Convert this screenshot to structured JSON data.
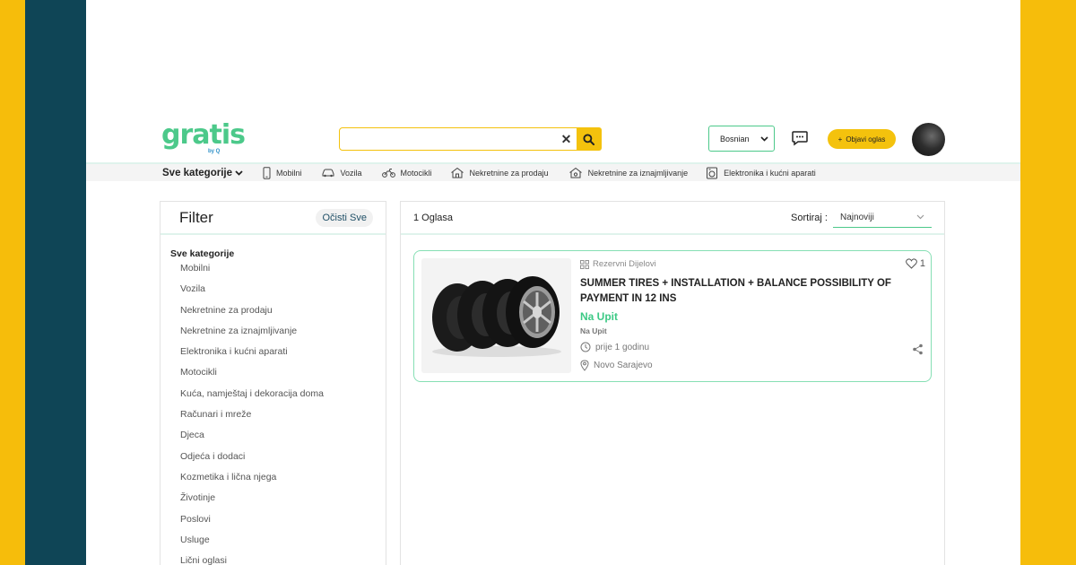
{
  "brand": {
    "logo_text": "gratis",
    "logo_sub": "by Q"
  },
  "search": {
    "value": "",
    "placeholder": ""
  },
  "header": {
    "language": "Bosnian",
    "post_ad_label": "Objavi oglas",
    "post_ad_icon": "+"
  },
  "categories_bar": {
    "all_label": "Sve kategorije",
    "items": [
      {
        "label": "Mobilni",
        "icon": "phone-icon"
      },
      {
        "label": "Vozila",
        "icon": "car-icon"
      },
      {
        "label": "Motocikli",
        "icon": "motorcycle-icon"
      },
      {
        "label": "Nekretnine za prodaju",
        "icon": "house-sale-icon"
      },
      {
        "label": "Nekretnine za iznajmljivanje",
        "icon": "house-rent-icon"
      },
      {
        "label": "Elektronika i kućni aparati",
        "icon": "appliance-icon"
      }
    ]
  },
  "filter": {
    "title": "Filter",
    "clear_label": "Očisti Sve",
    "root_label": "Sve kategorije",
    "items": [
      "Mobilni",
      "Vozila",
      "Nekretnine za prodaju",
      "Nekretnine za iznajmljivanje",
      "Elektronika i kućni aparati",
      "Motocikli",
      "Kuća, namještaj i dekoracija doma",
      "Računari i mreže",
      "Djeca",
      "Odjeća i dodaci",
      "Kozmetika i lična njega",
      "Životinje",
      "Poslovi",
      "Usluge",
      "Lični oglasi"
    ]
  },
  "results": {
    "count_label": "1 Oglasa",
    "sort_label": "Sortiraj :",
    "sort_value": "Najnoviji"
  },
  "listing": {
    "category": "Rezervni Dijelovi",
    "title": "SUMMER TIRES + INSTALLATION + BALANCE POSSIBILITY OF PAYMENT IN 12 INS",
    "price": "Na Upit",
    "price_sub": "Na Upit",
    "time": "prije 1 godinu",
    "location": "Novo Sarajevo",
    "favorites": "1"
  },
  "colors": {
    "accent_green": "#4cc98a",
    "accent_yellow": "#f4c20d",
    "frame_yellow": "#f6bd0b",
    "frame_dark": "#0f4556"
  }
}
